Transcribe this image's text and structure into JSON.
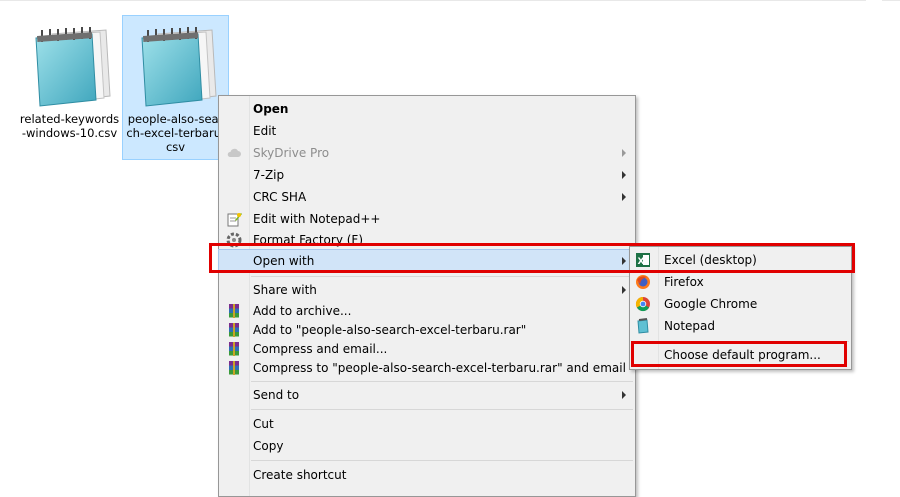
{
  "files": [
    {
      "name": "related-keywords\n-windows-10.csv",
      "selected": false
    },
    {
      "name": "people-also-sear\nch-excel-terbaru.\ncsv",
      "selected": true
    }
  ],
  "context_menu": {
    "items": {
      "open": "Open",
      "edit": "Edit",
      "skydrive": "SkyDrive Pro",
      "sevenzip": "7-Zip",
      "crcsha": "CRC SHA",
      "notepadpp": "Edit with Notepad++",
      "formatfactory": "Format Factory (F)",
      "openwith": "Open with",
      "sharewith": "Share with",
      "addarchive": "Add to archive...",
      "addrar": "Add to \"people-also-search-excel-terbaru.rar\"",
      "compressemail": "Compress and email...",
      "compressrar": "Compress to \"people-also-search-excel-terbaru.rar\" and email",
      "sendto": "Send to",
      "cut": "Cut",
      "copy": "Copy",
      "shortcut": "Create shortcut"
    },
    "icons": {
      "skydrive": "cloud-icon",
      "notepadpp": "notepadplusplus-icon",
      "formatfactory": "format-factory-icon",
      "winrar": "winrar-icon"
    }
  },
  "open_with_submenu": {
    "items": {
      "excel": "Excel (desktop)",
      "firefox": "Firefox",
      "chrome": "Google Chrome",
      "notepad": "Notepad",
      "choose": "Choose default program..."
    },
    "icons": {
      "excel": "excel-icon",
      "firefox": "firefox-icon",
      "chrome": "chrome-icon",
      "notepad": "notepad-icon"
    }
  },
  "colors": {
    "highlight": "#d1e4f8",
    "selection": "#cce8ff",
    "annotation_red": "#e00000"
  }
}
